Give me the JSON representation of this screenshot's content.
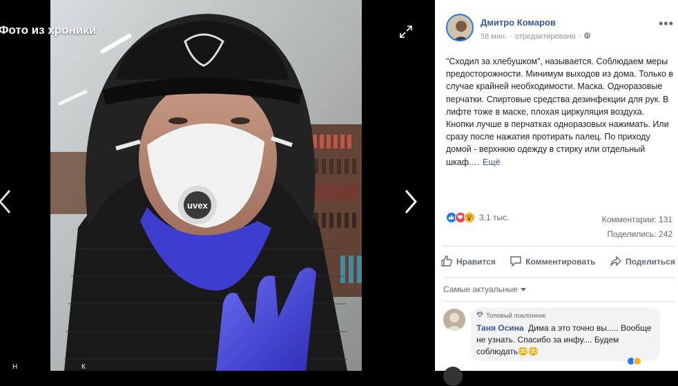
{
  "viewer": {
    "title": "Фото из хроники",
    "bottom_left": "Н",
    "bottom_mid": "К"
  },
  "post": {
    "author": "Дмитро Комаров",
    "time": "58 мин.",
    "edited": "отредактировано",
    "text": "\"Сходил за хлебушком\", называется. Соблюдаем меры предосторожности. Минимум выходов из дома. Только в случае крайней необходимости. Маска. Одноразовые перчатки. Спиртовые средства дезинфекции для рук. В лифте тоже в маске, плохая циркуляция воздуха. Кнопки лучше в перчатках одноразовых нажимать. Или сразу после нажатия протирать палец. По приходу домой - верхнюю одежду в стирку или отдельный шкаф.…",
    "more_link": "Ещё",
    "more_dots": "•••"
  },
  "stats": {
    "reactions": "3,1 тыс.",
    "comments": "Комментарии: 131",
    "shares": "Поделились: 242"
  },
  "actions": {
    "like": "Нравится",
    "comment": "Комментировать",
    "share": "Поделиться"
  },
  "comments": {
    "sort_label": "Самые актуальные",
    "items": [
      {
        "badge": "Топовый поклонник",
        "author": "Таня Осина",
        "text": "Дима а это точно вы..... Вообще не узнать. Спасибо за инфу.... Будем соблюдать😳😳"
      }
    ]
  },
  "photo": {
    "mask_brand": "uvex"
  },
  "colors": {
    "link": "#385898",
    "accent": "#1877f2",
    "muted": "#606770"
  },
  "icons": [
    "expand-icon",
    "arrow-left-icon",
    "arrow-right-icon",
    "globe-icon",
    "like-icon",
    "comment-icon",
    "share-icon",
    "caret-down-icon",
    "diamond-icon"
  ]
}
